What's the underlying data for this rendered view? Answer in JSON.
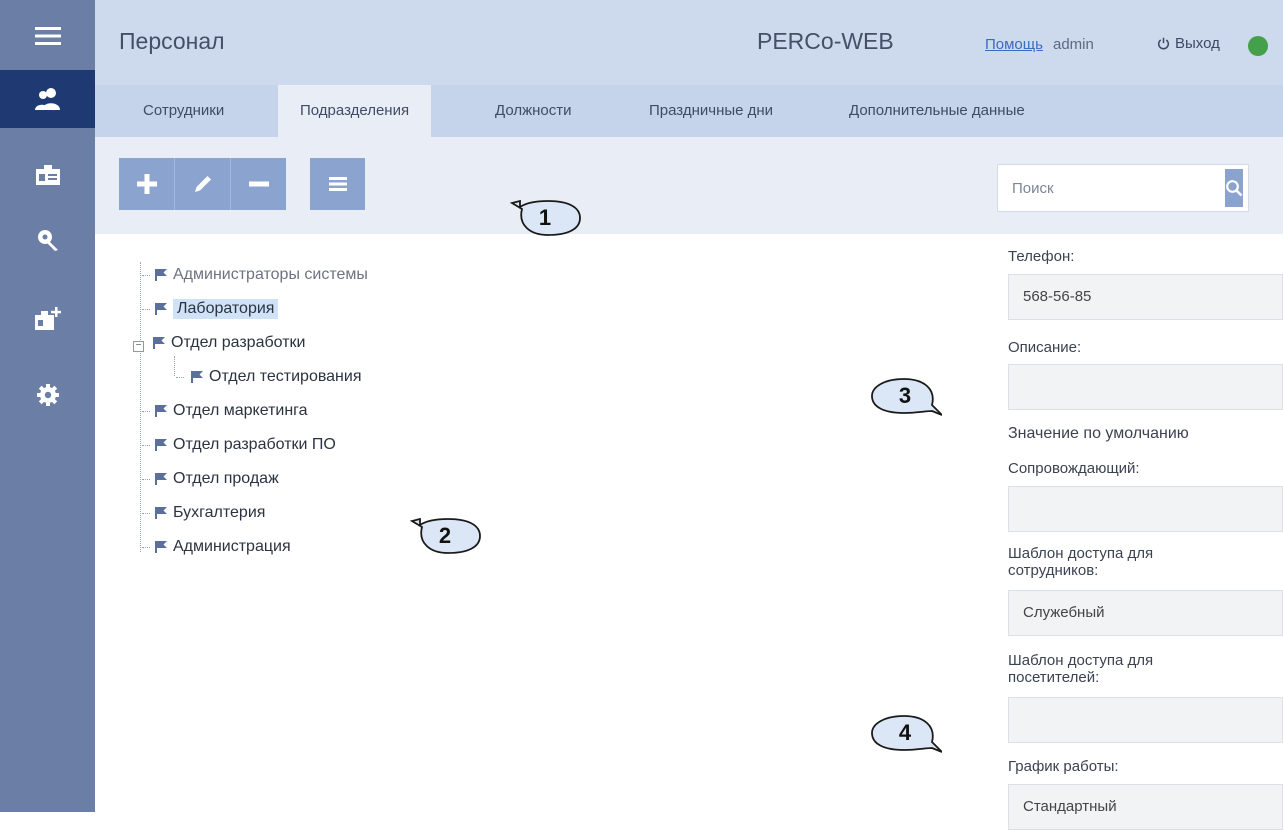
{
  "header": {
    "section_title": "Персонал",
    "brand": "PERCo-WEB",
    "help_label": "Помощь",
    "user_name": "admin",
    "logout_label": "Выход"
  },
  "colors": {
    "rail": "#6a7ea6",
    "rail_active": "#1f3a73",
    "header": "#cdd9ec",
    "accent": "#8ba3cf",
    "status_online": "#44a04a",
    "selection": "#cfe2f7"
  },
  "rail": {
    "items": [
      {
        "icon": "menu-icon"
      },
      {
        "icon": "staff-icon",
        "active": true
      },
      {
        "icon": "id-card-icon"
      },
      {
        "icon": "key-icon"
      },
      {
        "icon": "add-card-icon"
      },
      {
        "icon": "gear-icon"
      }
    ]
  },
  "tabs": [
    {
      "label": "Сотрудники"
    },
    {
      "label": "Подразделения",
      "active": true
    },
    {
      "label": "Должности"
    },
    {
      "label": "Праздничные дни"
    },
    {
      "label": "Дополнительные данные"
    }
  ],
  "toolbar": {
    "buttons": [
      "add-icon",
      "edit-icon",
      "remove-icon",
      "menu-icon"
    ]
  },
  "search": {
    "placeholder": "Поиск"
  },
  "tree": {
    "items": [
      {
        "label": "Администраторы системы",
        "level": 0
      },
      {
        "label": "Лаборатория",
        "level": 0,
        "selected": true
      },
      {
        "label": "Отдел разработки",
        "level": 0,
        "expanded": true
      },
      {
        "label": "Отдел тестирования",
        "level": 1
      },
      {
        "label": "Отдел маркетинга",
        "level": 0
      },
      {
        "label": "Отдел разработки ПО",
        "level": 0
      },
      {
        "label": "Отдел продаж",
        "level": 0
      },
      {
        "label": "Бухгалтерия",
        "level": 0
      },
      {
        "label": "Администрация",
        "level": 0
      }
    ]
  },
  "details": {
    "phone_label": "Телефон:",
    "phone_value": "568-56-85",
    "description_label": "Описание:",
    "description_value": "",
    "default_value_text": "Значение по умолчанию",
    "escort_label": "Сопровождающий:",
    "escort_value": "",
    "staff_template_label_1": "Шаблон доступа для",
    "staff_template_label_2": "сотрудников:",
    "staff_template_value": "Служебный",
    "visitor_template_label_1": "Шаблон доступа для",
    "visitor_template_label_2": "посетителей:",
    "visitor_template_value": "",
    "schedule_label": "График работы:",
    "schedule_value": "Стандартный"
  },
  "callouts": [
    "1",
    "2",
    "3",
    "4"
  ]
}
